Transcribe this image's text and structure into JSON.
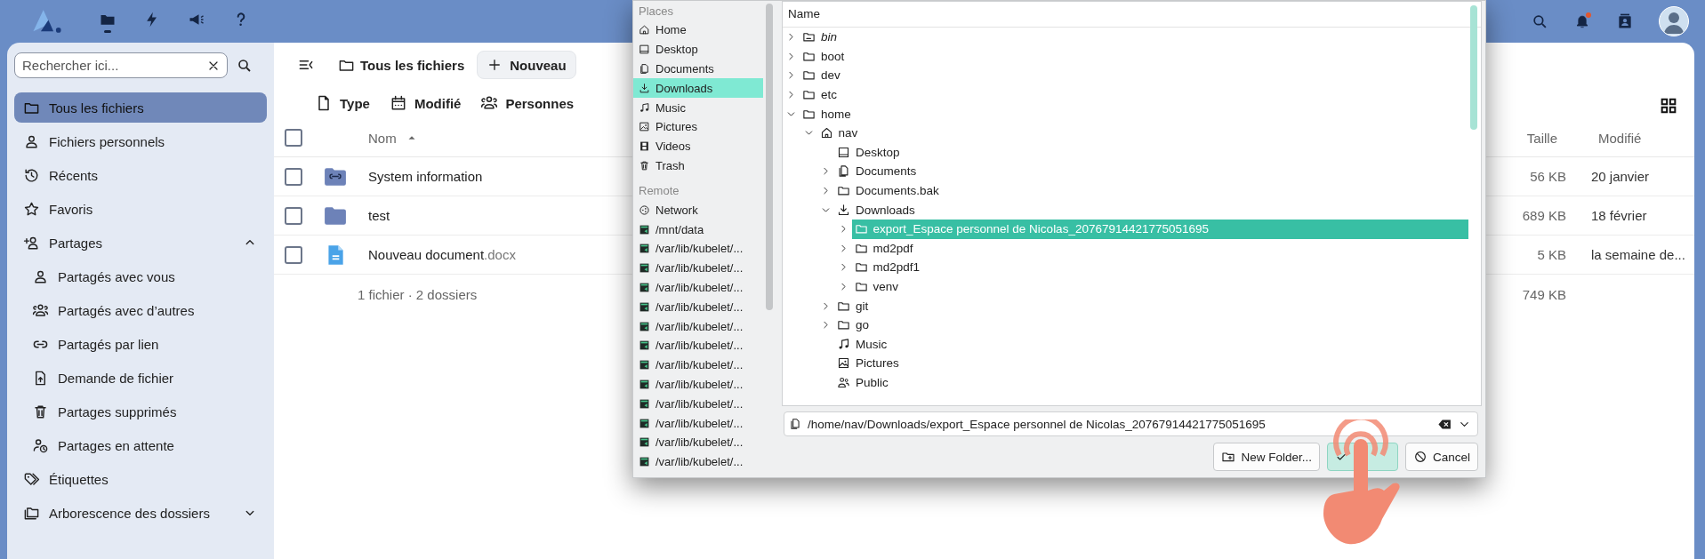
{
  "topbar": {
    "apps": [
      {
        "kind": "files",
        "selected": true
      },
      {
        "kind": "activity",
        "selected": false
      },
      {
        "kind": "announcements",
        "selected": false
      },
      {
        "kind": "help",
        "selected": false
      }
    ],
    "notifications_unread": true
  },
  "sidebar": {
    "search": {
      "placeholder": "Rechercher ici..."
    },
    "items": [
      {
        "label": "Tous les fichiers",
        "kind": "folder",
        "selected": true
      },
      {
        "label": "Fichiers personnels",
        "kind": "person",
        "selected": false
      },
      {
        "label": "Récents",
        "kind": "history",
        "selected": false
      },
      {
        "label": "Favoris",
        "kind": "star",
        "selected": false
      },
      {
        "label": "Partages",
        "kind": "share",
        "selected": false,
        "expanded": true,
        "children": [
          {
            "label": "Partagés avec vous",
            "kind": "person",
            "selected": false
          },
          {
            "label": "Partagés avec d’autres",
            "kind": "people",
            "selected": false
          },
          {
            "label": "Partagés par lien",
            "kind": "link",
            "selected": false
          },
          {
            "label": "Demande de fichier",
            "kind": "file-upload",
            "selected": false
          },
          {
            "label": "Partages supprimés",
            "kind": "trash",
            "selected": false
          },
          {
            "label": "Partages en attente",
            "kind": "person-clock",
            "selected": false
          }
        ]
      },
      {
        "label": "Étiquettes",
        "kind": "tag",
        "selected": false
      },
      {
        "label": "Arborescence des dossiers",
        "kind": "folders",
        "selected": false,
        "expanded": false
      }
    ]
  },
  "toolbar": {
    "breadcrumb": "Tous les fichiers",
    "new_button": "Nouveau"
  },
  "filters": [
    {
      "label": "Type",
      "kind": "file"
    },
    {
      "label": "Modifié",
      "kind": "calendar"
    },
    {
      "label": "Personnes",
      "kind": "people"
    }
  ],
  "table": {
    "all_checked": false,
    "columns": [
      {
        "label": "Nom",
        "sorted": true
      },
      {
        "label": "Taille"
      },
      {
        "label": "Modifié"
      }
    ],
    "rows": [
      {
        "name": "System information",
        "kind": "shared-folder",
        "size": "56 KB",
        "modified": "20 janvier",
        "checked": false
      },
      {
        "name": "test",
        "kind": "folder",
        "size": "689 KB",
        "modified": "18 février",
        "checked": false
      },
      {
        "name": "Nouveau document",
        "extension": ".docx",
        "kind": "document",
        "size": "5 KB",
        "modified": "la semaine de...",
        "checked": false
      }
    ],
    "summary": {
      "label": "1 fichier · 2 dossiers",
      "size": "749 KB"
    }
  },
  "dialog": {
    "places": [
      {
        "header": "Places",
        "items": [
          {
            "label": "Home",
            "kind": "home",
            "selected": false
          },
          {
            "label": "Desktop",
            "kind": "desktop",
            "selected": false
          },
          {
            "label": "Documents",
            "kind": "documents",
            "selected": false
          },
          {
            "label": "Downloads",
            "kind": "downloads",
            "selected": true
          },
          {
            "label": "Music",
            "kind": "music",
            "selected": false
          },
          {
            "label": "Pictures",
            "kind": "pictures",
            "selected": false
          },
          {
            "label": "Videos",
            "kind": "videos",
            "selected": false
          },
          {
            "label": "Trash",
            "kind": "trash",
            "selected": false
          }
        ]
      },
      {
        "header": "Remote",
        "items": [
          {
            "label": "Network",
            "kind": "network",
            "selected": false
          },
          {
            "label": "/mnt/data",
            "kind": "mount",
            "selected": false
          },
          {
            "label": "/var/lib/kubelet/...",
            "kind": "mount",
            "selected": false
          },
          {
            "label": "/var/lib/kubelet/...",
            "kind": "mount",
            "selected": false
          },
          {
            "label": "/var/lib/kubelet/...",
            "kind": "mount",
            "selected": false
          },
          {
            "label": "/var/lib/kubelet/...",
            "kind": "mount",
            "selected": false
          },
          {
            "label": "/var/lib/kubelet/...",
            "kind": "mount",
            "selected": false
          },
          {
            "label": "/var/lib/kubelet/...",
            "kind": "mount",
            "selected": false
          },
          {
            "label": "/var/lib/kubelet/...",
            "kind": "mount",
            "selected": false
          },
          {
            "label": "/var/lib/kubelet/...",
            "kind": "mount",
            "selected": false
          },
          {
            "label": "/var/lib/kubelet/...",
            "kind": "mount",
            "selected": false
          },
          {
            "label": "/var/lib/kubelet/...",
            "kind": "mount",
            "selected": false
          },
          {
            "label": "/var/lib/kubelet/...",
            "kind": "mount",
            "selected": false
          },
          {
            "label": "/var/lib/kubelet/...",
            "kind": "mount",
            "selected": false
          }
        ]
      }
    ],
    "tree_header": "Name",
    "tree": [
      {
        "label": "bin",
        "kind": "symlink",
        "expanded": false,
        "selected": false
      },
      {
        "label": "boot",
        "kind": "folder",
        "expanded": false,
        "selected": false
      },
      {
        "label": "dev",
        "kind": "folder",
        "expanded": false,
        "selected": false
      },
      {
        "label": "etc",
        "kind": "folder",
        "expanded": false,
        "selected": false
      },
      {
        "label": "home",
        "kind": "folder",
        "expanded": true,
        "selected": false,
        "children": [
          {
            "label": "nav",
            "kind": "home",
            "expanded": true,
            "selected": false,
            "children": [
              {
                "label": "Desktop",
                "kind": "desktop",
                "selected": false
              },
              {
                "label": "Documents",
                "kind": "documents",
                "expanded": false,
                "selected": false
              },
              {
                "label": "Documents.bak",
                "kind": "folder",
                "expanded": false,
                "selected": false
              },
              {
                "label": "Downloads",
                "kind": "downloads",
                "expanded": true,
                "selected": false,
                "children": [
                  {
                    "label": "export_Espace personnel de Nicolas_20767914421775051695",
                    "kind": "folder",
                    "expanded": false,
                    "selected": true
                  },
                  {
                    "label": "md2pdf",
                    "kind": "folder",
                    "expanded": false,
                    "selected": false
                  },
                  {
                    "label": "md2pdf1",
                    "kind": "folder",
                    "expanded": false,
                    "selected": false
                  },
                  {
                    "label": "venv",
                    "kind": "folder",
                    "expanded": false,
                    "selected": false
                  }
                ]
              },
              {
                "label": "git",
                "kind": "folder",
                "expanded": false,
                "selected": false
              },
              {
                "label": "go",
                "kind": "folder",
                "expanded": false,
                "selected": false
              },
              {
                "label": "Music",
                "kind": "music",
                "selected": false
              },
              {
                "label": "Pictures",
                "kind": "pictures",
                "selected": false
              },
              {
                "label": "Public",
                "kind": "public",
                "selected": false
              }
            ]
          }
        ]
      }
    ],
    "path": "/home/nav/Downloads/export_Espace personnel de Nicolas_20767914421775051695",
    "buttons": [
      {
        "label": "New Folder...",
        "kind": "new-folder"
      },
      {
        "kind": "confirm"
      },
      {
        "label": "Cancel",
        "kind": "cancel"
      }
    ]
  }
}
